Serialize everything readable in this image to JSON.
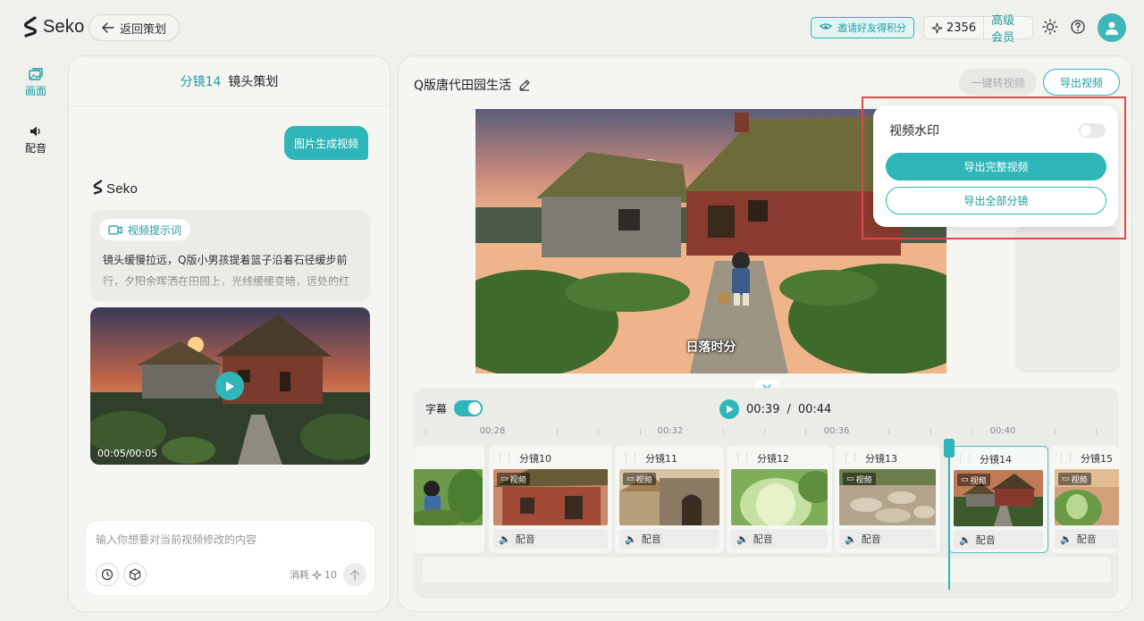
{
  "app": {
    "name": "Seko"
  },
  "header": {
    "back_label": "返回策划",
    "invite_label": "邀请好友得积分",
    "credits": "2356",
    "membership": "高级会员"
  },
  "rail": {
    "items": [
      {
        "label": "画面",
        "icon": "image-icon",
        "active": true
      },
      {
        "label": "配音",
        "icon": "speaker-icon",
        "active": false
      }
    ]
  },
  "left_panel": {
    "shot_label": "分镜14",
    "title": "镜头策划",
    "user_message": "图片生成视频",
    "reply_brand": "Seko",
    "prompt_tag": "视频提示词",
    "prompt_text": "镜头缓慢拉远，Q版小男孩提着篮子沿着石径缓步前行，夕阳余晖洒在田园上，光线缓缓变暗，远处的红",
    "video_time": "00:05/00:05",
    "input_placeholder": "输入你想要对当前视频修改的内容",
    "cost_label": "消耗",
    "cost_value": "10"
  },
  "right_panel": {
    "project_title": "Q版唐代田园生活",
    "convert_label": "一键转视频",
    "export_label": "导出视频",
    "subtitle_text": "日落时分",
    "timeline": {
      "subtitle_toggle_label": "字幕",
      "current_time": "00:39",
      "separator": "/",
      "total_time": "00:44",
      "ruler_labels": [
        "00:28",
        "00:32",
        "00:36",
        "00:40"
      ],
      "clips": [
        {
          "name": "",
          "badge": "",
          "audio": ""
        },
        {
          "name": "分镜10",
          "badge": "视频",
          "audio": "配音"
        },
        {
          "name": "分镜11",
          "badge": "视频",
          "audio": "配音"
        },
        {
          "name": "分镜12",
          "badge": "",
          "audio": "配音"
        },
        {
          "name": "分镜13",
          "badge": "视频",
          "audio": "配音"
        },
        {
          "name": "分镜14",
          "badge": "视频",
          "audio": "配音"
        },
        {
          "name": "分镜15",
          "badge": "视频",
          "audio": "配音"
        }
      ]
    }
  },
  "export_menu": {
    "watermark_label": "视频水印",
    "watermark_on": false,
    "export_full_label": "导出完整视频",
    "export_all_label": "导出全部分镜"
  },
  "colors": {
    "accent": "#2fb6b8",
    "accent_text": "#1f9ea2",
    "highlight": "#e04848"
  }
}
